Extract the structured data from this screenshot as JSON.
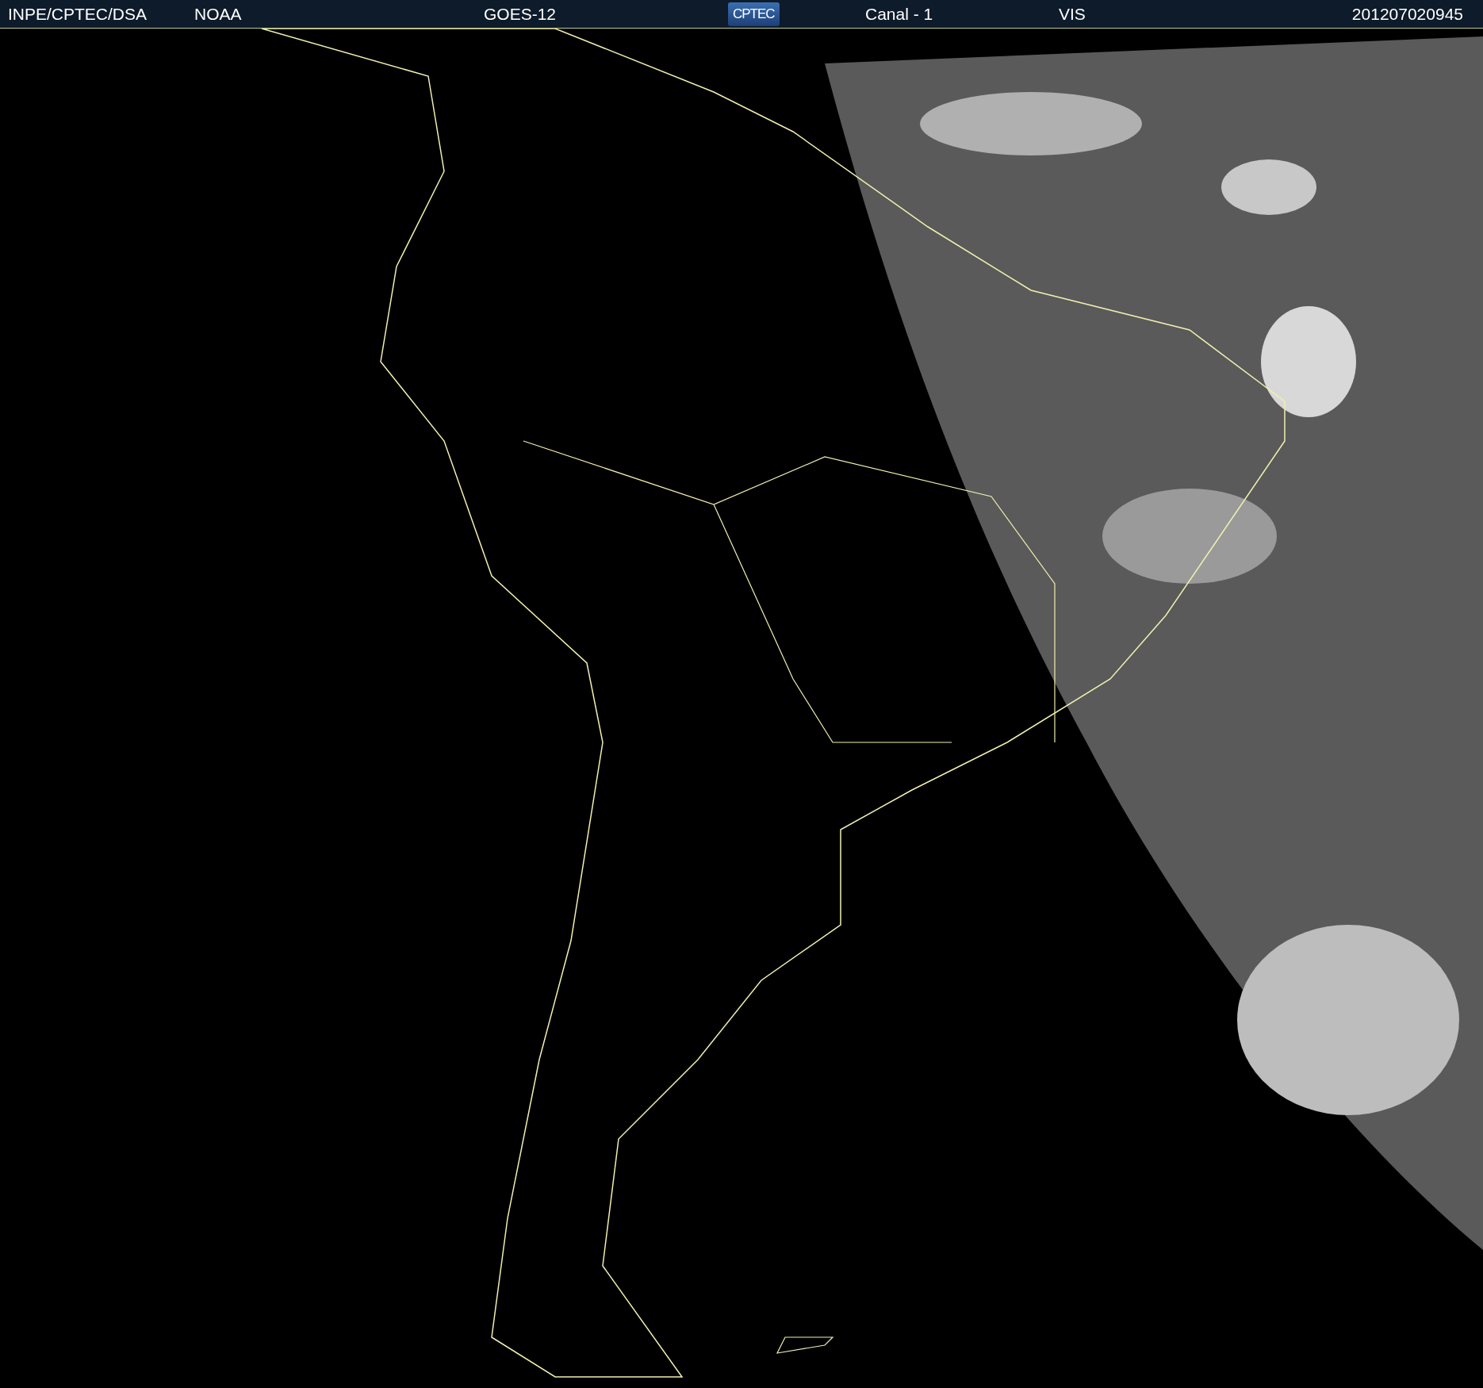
{
  "header": {
    "items": [
      {
        "kind": "text",
        "text": "INPE/CPTEC/DSA"
      },
      {
        "kind": "text",
        "text": "NOAA"
      },
      {
        "kind": "text",
        "text": "GOES-12"
      },
      {
        "kind": "logo",
        "text": "CPTEC"
      },
      {
        "kind": "text",
        "text": "Canal - 1"
      },
      {
        "kind": "text",
        "text": "VIS"
      },
      {
        "kind": "text",
        "text": "201207020945"
      }
    ]
  }
}
